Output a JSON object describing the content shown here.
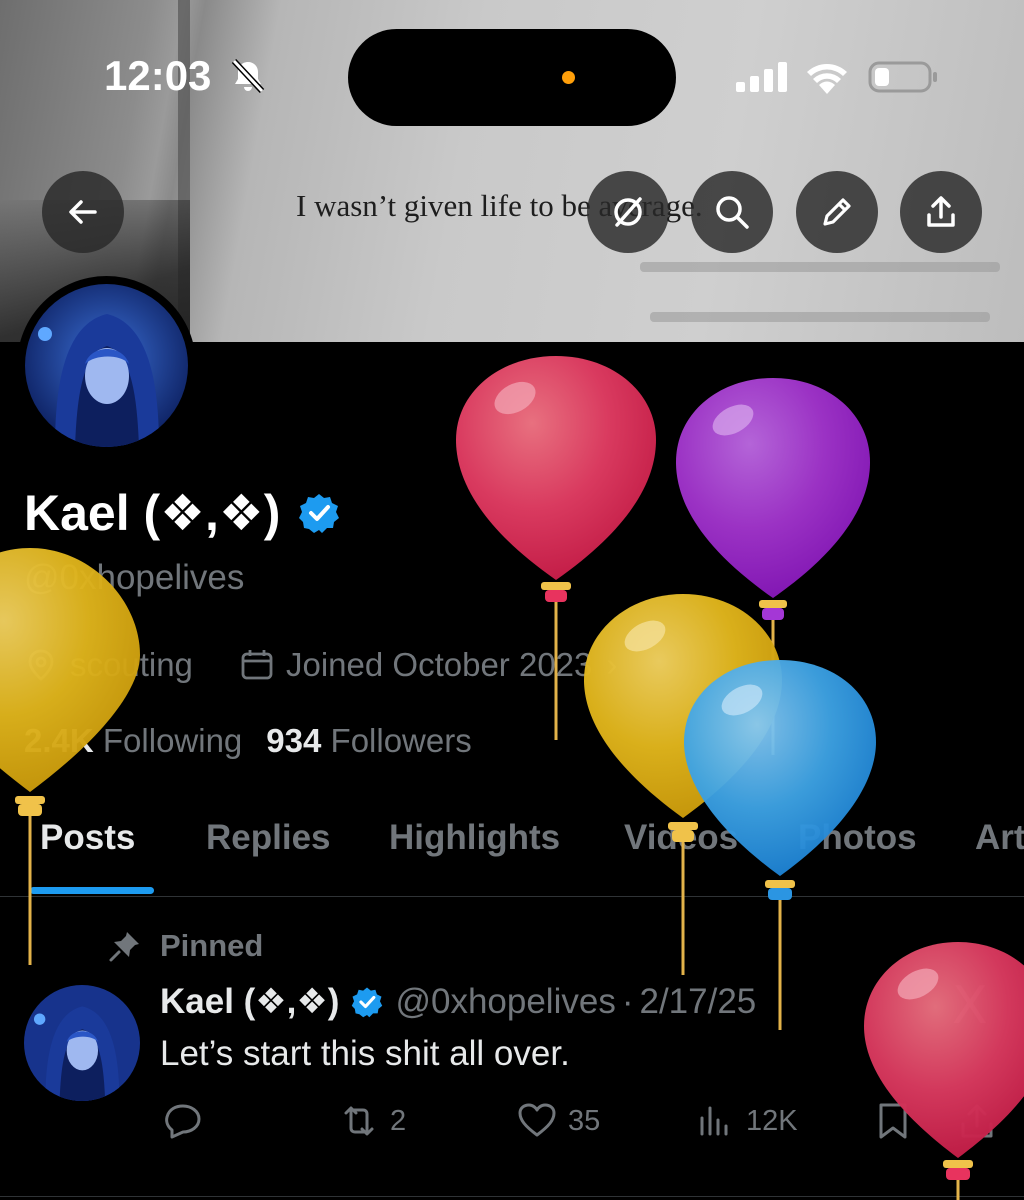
{
  "status_bar": {
    "time": "12:03",
    "icons": [
      "bell-slash-icon",
      "signal-icon",
      "wifi-icon",
      "battery-icon"
    ]
  },
  "banner": {
    "quote": "I wasn’t given life to be average."
  },
  "header_buttons": [
    "back-icon",
    "grok-icon",
    "search-icon",
    "edit-icon",
    "share-icon"
  ],
  "profile": {
    "name": "Kael (❖,❖)",
    "handle": "@0xhopelives",
    "location": "scouting",
    "joined": "Joined October 2023",
    "following_count": "2.4K",
    "following_label": "Following",
    "followers_count": "934",
    "followers_label": "Followers"
  },
  "tabs": [
    "Posts",
    "Replies",
    "Highlights",
    "Videos",
    "Photos",
    "Art"
  ],
  "active_tab": "Posts",
  "post": {
    "pinned_label": "Pinned",
    "name": "Kael (❖,❖)",
    "handle": "@0xhopelives",
    "separator": "·",
    "date": "2/17/25",
    "text": "Let’s start this shit all over.",
    "retweets": "2",
    "likes": "35",
    "views": "12K",
    "x_mark": "X"
  },
  "colors": {
    "background": "#000000",
    "accent": "#1d9bf0",
    "secondary_text": "#71767b",
    "primary_text": "#e7e9ea",
    "balloon_red": "#d93a5f",
    "balloon_purple": "#9b32c4",
    "balloon_yellow": "#e0b51c",
    "balloon_blue": "#3ea4e6"
  }
}
